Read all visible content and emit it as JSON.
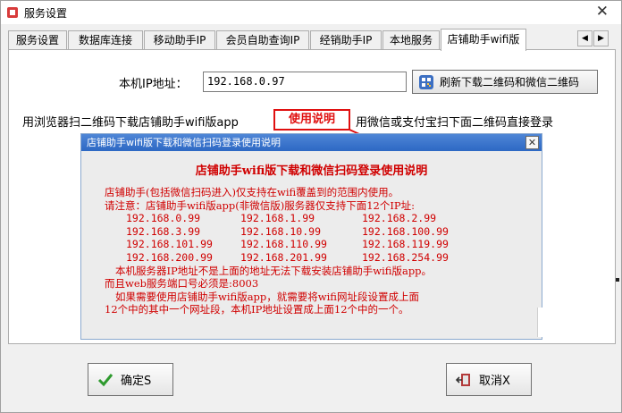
{
  "window": {
    "title": "服务设置",
    "close_glyph": "✕"
  },
  "tabs": [
    {
      "label": "服务设置",
      "active": false
    },
    {
      "label": "数据库连接",
      "active": false
    },
    {
      "label": "移动助手IP",
      "active": false
    },
    {
      "label": "会员自助查询IP",
      "active": false
    },
    {
      "label": "经销助手IP",
      "active": false
    },
    {
      "label": "本地服务",
      "active": false
    },
    {
      "label": "店铺助手wifi版",
      "active": true
    }
  ],
  "tab_scroll": {
    "left": "◀",
    "right": "▶"
  },
  "form": {
    "ip_label": "本机IP地址：",
    "ip_value": "192.168.0.97",
    "refresh_label": "刷新下载二维码和微信二维码",
    "hint_left": "用浏览器扫二维码下载店铺助手wifi版app",
    "usage_label": "使用说明",
    "hint_right": "用微信或支付宝扫下面二维码直接登录"
  },
  "popup": {
    "title": "店铺助手wifi版下载和微信扫码登录使用说明",
    "close_glyph": "✕",
    "heading": "店铺助手wifi版下载和微信扫码登录使用说明",
    "line1": "店铺助手(包括微信扫码进入)仅支持在wifi覆盖到的范围内使用。",
    "line2": "请注意：店铺助手wifi版app(非微信版)服务器仅支持下面12个IP址:",
    "ips": [
      "192.168.0.99",
      "192.168.1.99",
      "192.168.2.99",
      "192.168.3.99",
      "192.168.10.99",
      "192.168.100.99",
      "192.168.101.99",
      "192.168.110.99",
      "192.168.119.99",
      "192.168.200.99",
      "192.168.201.99",
      "192.168.254.99"
    ],
    "line3": "本机服务器IP地址不是上面的地址无法下载安装店铺助手wifi版app。",
    "line4": "而且web服务端口号必须是:8003",
    "line5": "如果需要使用店铺助手wifi版app，就需要将wifi网址段设置成上面",
    "line6": "12个中的其中一个网址段，本机IP地址设置成上面12个中的一个。"
  },
  "buttons": {
    "ok": "确定S",
    "cancel": "取消X"
  },
  "colors": {
    "accent_red": "#d00000",
    "popup_title_bar": "#2d68c4"
  }
}
